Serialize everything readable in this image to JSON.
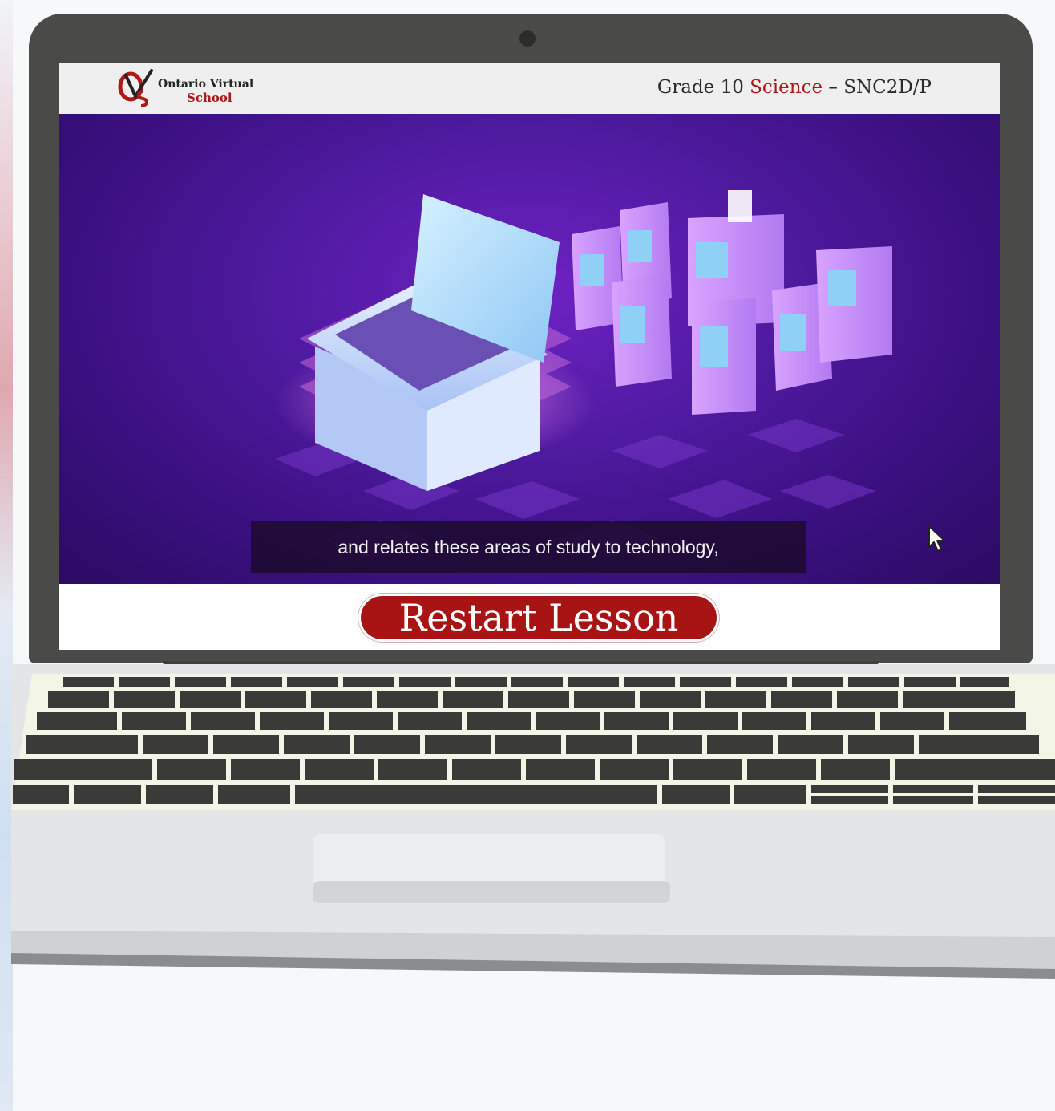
{
  "header": {
    "logo": {
      "line1": "Ontario Virtual",
      "line2": "School",
      "mark_letters": "OVS"
    },
    "course": {
      "prefix": "Grade 10 ",
      "subject": "Science",
      "suffix": " – SNC2D/P"
    }
  },
  "video": {
    "caption": "and relates these areas of study to technology,"
  },
  "actions": {
    "restart_label": "Restart Lesson"
  },
  "colors": {
    "brand_red": "#a81414",
    "video_purple": "#4f1aa0",
    "bezel": "#4a4a48"
  },
  "icons": {
    "cursor": "mouse-pointer-icon",
    "logo": "ovs-logo-icon"
  }
}
